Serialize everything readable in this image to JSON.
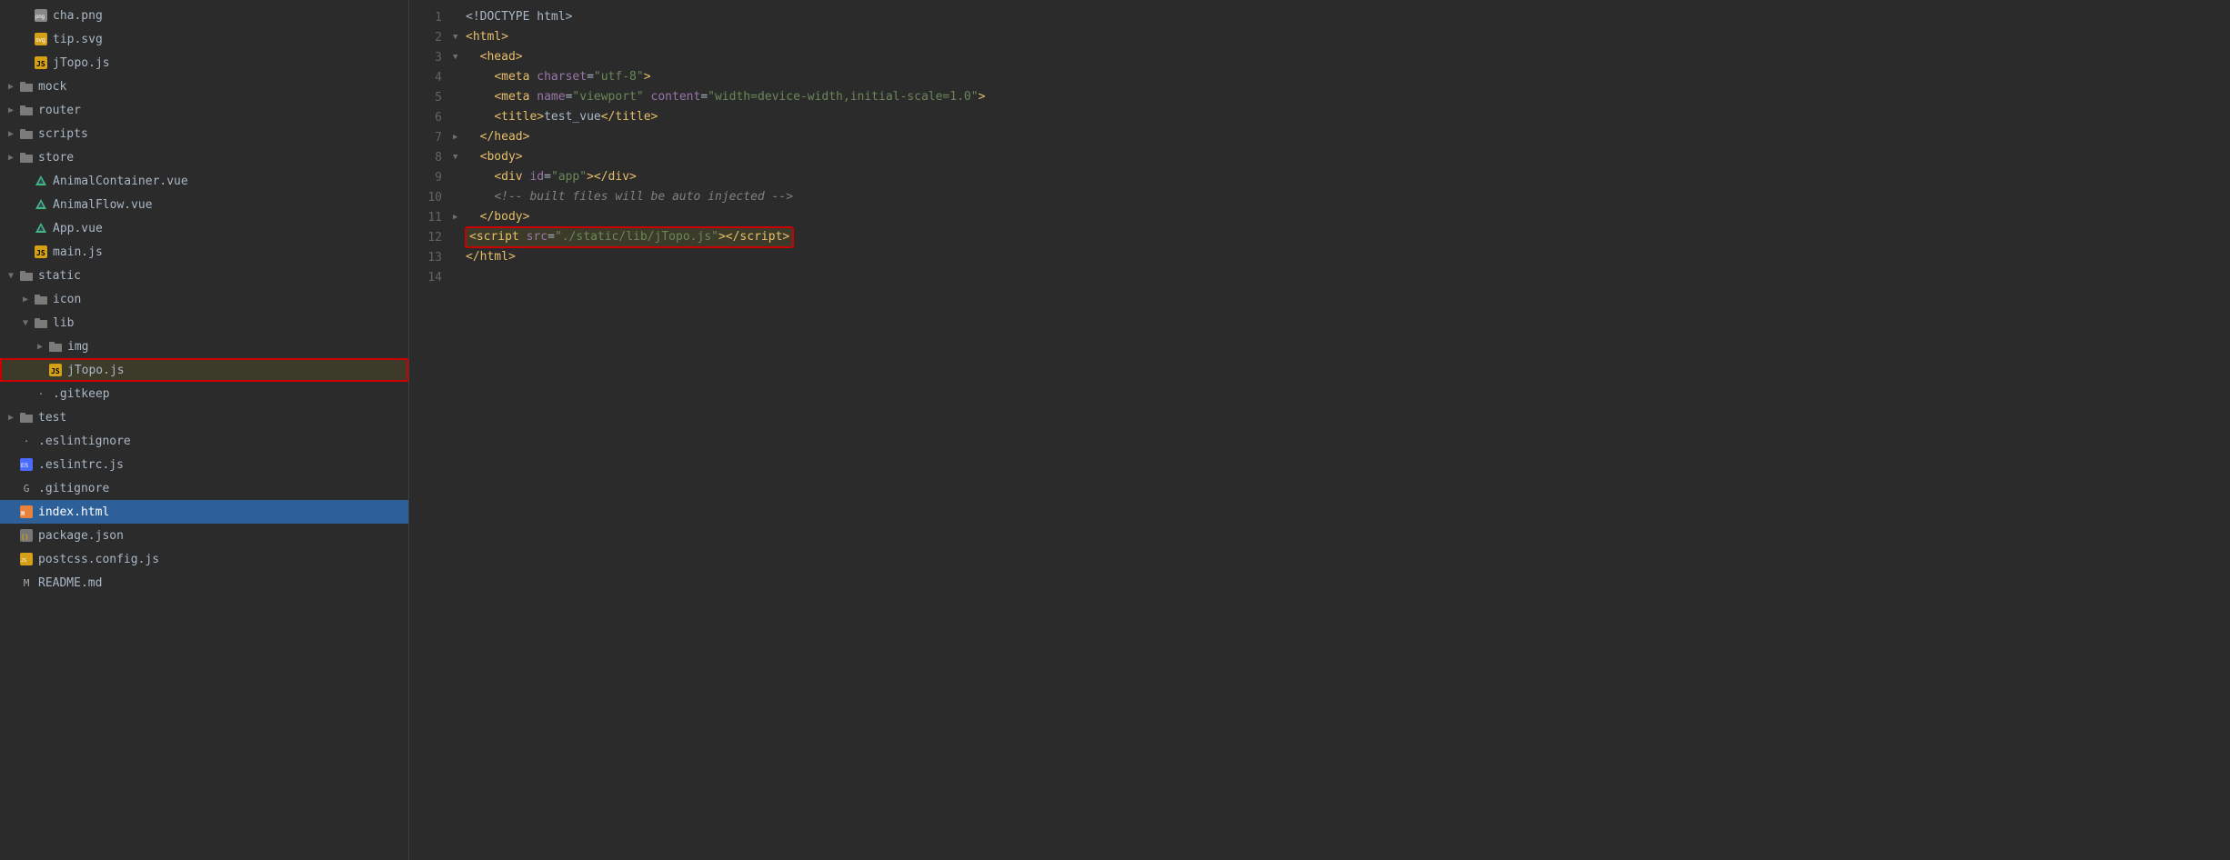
{
  "sidebar": {
    "items": [
      {
        "id": "cha-png",
        "label": "cha.png",
        "type": "png",
        "indent": 1,
        "arrow": "empty",
        "selected": false,
        "highlighted": false
      },
      {
        "id": "tip-svg",
        "label": "tip.svg",
        "type": "svg",
        "indent": 1,
        "arrow": "empty",
        "selected": false,
        "highlighted": false
      },
      {
        "id": "jTopo-js-top",
        "label": "jTopo.js",
        "type": "js",
        "indent": 1,
        "arrow": "empty",
        "selected": false,
        "highlighted": false
      },
      {
        "id": "mock",
        "label": "mock",
        "type": "folder",
        "indent": 0,
        "arrow": "collapsed",
        "selected": false,
        "highlighted": false
      },
      {
        "id": "router",
        "label": "router",
        "type": "folder",
        "indent": 0,
        "arrow": "collapsed",
        "selected": false,
        "highlighted": false
      },
      {
        "id": "scripts",
        "label": "scripts",
        "type": "folder",
        "indent": 0,
        "arrow": "collapsed",
        "selected": false,
        "highlighted": false
      },
      {
        "id": "store",
        "label": "store",
        "type": "folder",
        "indent": 0,
        "arrow": "collapsed",
        "selected": false,
        "highlighted": false
      },
      {
        "id": "animal-container-vue",
        "label": "AnimalContainer.vue",
        "type": "vue",
        "indent": 1,
        "arrow": "empty",
        "selected": false,
        "highlighted": false
      },
      {
        "id": "animal-flow-vue",
        "label": "AnimalFlow.vue",
        "type": "vue",
        "indent": 1,
        "arrow": "empty",
        "selected": false,
        "highlighted": false
      },
      {
        "id": "app-vue",
        "label": "App.vue",
        "type": "vue",
        "indent": 1,
        "arrow": "empty",
        "selected": false,
        "highlighted": false
      },
      {
        "id": "main-js",
        "label": "main.js",
        "type": "js",
        "indent": 1,
        "arrow": "empty",
        "selected": false,
        "highlighted": false
      },
      {
        "id": "static",
        "label": "static",
        "type": "folder",
        "indent": 0,
        "arrow": "expanded",
        "selected": false,
        "highlighted": false
      },
      {
        "id": "icon",
        "label": "icon",
        "type": "folder",
        "indent": 1,
        "arrow": "collapsed",
        "selected": false,
        "highlighted": false
      },
      {
        "id": "lib",
        "label": "lib",
        "type": "folder",
        "indent": 1,
        "arrow": "expanded",
        "selected": false,
        "highlighted": false
      },
      {
        "id": "img",
        "label": "img",
        "type": "folder",
        "indent": 2,
        "arrow": "collapsed",
        "selected": false,
        "highlighted": false
      },
      {
        "id": "jTopo-js",
        "label": "jTopo.js",
        "type": "js",
        "indent": 2,
        "arrow": "empty",
        "selected": false,
        "highlighted": true
      },
      {
        "id": "gitkeep",
        "label": ".gitkeep",
        "type": "plain",
        "indent": 1,
        "arrow": "empty",
        "selected": false,
        "highlighted": false
      },
      {
        "id": "test",
        "label": "test",
        "type": "folder",
        "indent": 0,
        "arrow": "collapsed",
        "selected": false,
        "highlighted": false
      },
      {
        "id": "eslintignore",
        "label": ".eslintignore",
        "type": "plain",
        "indent": 0,
        "arrow": "empty",
        "selected": false,
        "highlighted": false
      },
      {
        "id": "eslintrc-js",
        "label": ".eslintrc.js",
        "type": "eslint",
        "indent": 0,
        "arrow": "empty",
        "selected": false,
        "highlighted": false
      },
      {
        "id": "gitignore",
        "label": ".gitignore",
        "type": "gitignore",
        "indent": 0,
        "arrow": "empty",
        "selected": false,
        "highlighted": false
      },
      {
        "id": "index-html",
        "label": "index.html",
        "type": "html",
        "indent": 0,
        "arrow": "empty",
        "selected": true,
        "highlighted": false
      },
      {
        "id": "package-json",
        "label": "package.json",
        "type": "json",
        "indent": 0,
        "arrow": "empty",
        "selected": false,
        "highlighted": false
      },
      {
        "id": "postcss-config-js",
        "label": "postcss.config.js",
        "type": "postcss",
        "indent": 0,
        "arrow": "empty",
        "selected": false,
        "highlighted": false
      },
      {
        "id": "readme-md",
        "label": "README.md",
        "type": "md",
        "indent": 0,
        "arrow": "empty",
        "selected": false,
        "highlighted": false
      }
    ]
  },
  "editor": {
    "lines": [
      {
        "num": 1,
        "fold": "",
        "content_html": "<span class='tok-text'>&lt;!DOCTYPE html&gt;</span>"
      },
      {
        "num": 2,
        "fold": "expanded",
        "content_html": "<span class='tok-tag'>&lt;html&gt;</span>"
      },
      {
        "num": 3,
        "fold": "expanded",
        "content_html": "  <span class='tok-tag'>&lt;head&gt;</span>"
      },
      {
        "num": 4,
        "fold": "",
        "content_html": "    <span class='tok-tag'>&lt;meta</span> <span class='tok-attr'>charset</span><span class='tok-text'>=</span><span class='tok-string'>\"utf-8\"</span><span class='tok-tag'>&gt;</span>"
      },
      {
        "num": 5,
        "fold": "",
        "content_html": "    <span class='tok-tag'>&lt;meta</span> <span class='tok-attr'>name</span><span class='tok-text'>=</span><span class='tok-string'>\"viewport\"</span> <span class='tok-attr'>content</span><span class='tok-text'>=</span><span class='tok-string'>\"width=device-width,initial-scale=1.0\"</span><span class='tok-tag'>&gt;</span>"
      },
      {
        "num": 6,
        "fold": "",
        "content_html": "    <span class='tok-tag'>&lt;title&gt;</span><span class='tok-text'>test_vue</span><span class='tok-tag'>&lt;/title&gt;</span>"
      },
      {
        "num": 7,
        "fold": "collapsed",
        "content_html": "  <span class='tok-tag'>&lt;/head&gt;</span>"
      },
      {
        "num": 8,
        "fold": "expanded",
        "content_html": "  <span class='tok-tag'>&lt;body&gt;</span>"
      },
      {
        "num": 9,
        "fold": "",
        "content_html": "    <span class='tok-tag'>&lt;div</span> <span class='tok-attr'>id</span><span class='tok-text'>=</span><span class='tok-string'>\"app\"</span><span class='tok-tag'>&gt;&lt;/div&gt;</span>"
      },
      {
        "num": 10,
        "fold": "",
        "content_html": "    <span class='tok-comment'>&lt;!-- built files will be auto injected --&gt;</span>"
      },
      {
        "num": 11,
        "fold": "collapsed",
        "content_html": "  <span class='tok-tag'>&lt;/body&gt;</span>"
      },
      {
        "num": 12,
        "fold": "",
        "highlighted": true,
        "content_html": "<span class='tok-tag'>&lt;script</span> <span class='tok-attr'>src</span><span class='tok-text'>=</span><span class='tok-string'>\"./static/lib/jTopo.js\"</span><span class='tok-tag'>&gt;&lt;/script&gt;</span>"
      },
      {
        "num": 13,
        "fold": "",
        "content_html": "<span class='tok-tag'>&lt;/html&gt;</span>"
      },
      {
        "num": 14,
        "fold": "",
        "content_html": ""
      }
    ]
  },
  "icons": {
    "folder": "📁",
    "js": "JS",
    "vue": "V",
    "html": "H",
    "json": "{}",
    "svg": "S",
    "png": "P",
    "plain": "·",
    "gitignore": "G",
    "eslint": "E",
    "md": "M",
    "postcss": "P"
  }
}
